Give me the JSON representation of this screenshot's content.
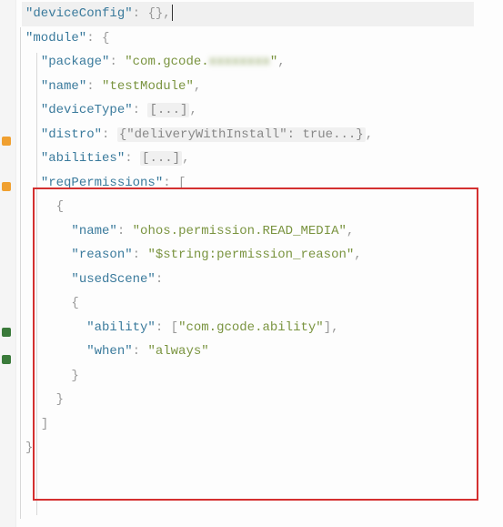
{
  "code": {
    "deviceConfig_key": "\"deviceConfig\"",
    "deviceConfig_val": "{}",
    "module_key": "\"module\"",
    "module_open": "{",
    "package_key": "\"package\"",
    "package_val": "\"com.gcode.",
    "package_val_blur": "xxxxxxxx",
    "package_val_end": "\"",
    "name_key": "\"name\"",
    "name_val": "\"testModule\"",
    "deviceType_key": "\"deviceType\"",
    "deviceType_val": "[...]",
    "distro_key": "\"distro\"",
    "distro_val": "{\"deliveryWithInstall\": true...}",
    "abilities_key": "\"abilities\"",
    "abilities_val": "[...]",
    "reqPermissions_key": "\"reqPermissions\"",
    "reqPermissions_open": "[",
    "obj_open": "{",
    "perm_name_key": "\"name\"",
    "perm_name_val": "\"ohos.permission.READ_MEDIA\"",
    "reason_key": "\"reason\"",
    "reason_val": "\"$string:permission_reason\"",
    "usedScene_key": "\"usedScene\"",
    "usedScene_open": "{",
    "ability_key": "\"ability\"",
    "ability_open": "[",
    "ability_val": "\"com.gcode.ability\"",
    "ability_close": "]",
    "when_key": "\"when\"",
    "when_val": "\"always\"",
    "usedScene_close": "}",
    "obj_close": "}",
    "reqPermissions_close": "]",
    "module_close": "}",
    "colon": ": ",
    "comma": ","
  }
}
